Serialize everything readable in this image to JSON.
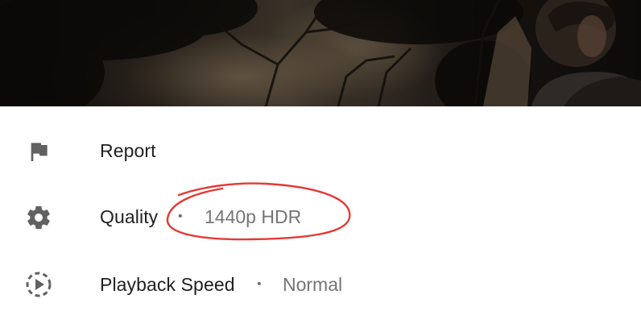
{
  "menu": {
    "items": [
      {
        "label": "Report",
        "icon": "flag-icon"
      },
      {
        "label": "Quality",
        "value": "1440p HDR",
        "separator": "•",
        "icon": "gear-icon"
      },
      {
        "label": "Playback Speed",
        "value": "Normal",
        "separator": "•",
        "icon": "playback-speed-icon"
      }
    ]
  },
  "colors": {
    "label": "#212121",
    "secondary": "#757575",
    "icon": "#616161",
    "annotation": "#e53935"
  }
}
